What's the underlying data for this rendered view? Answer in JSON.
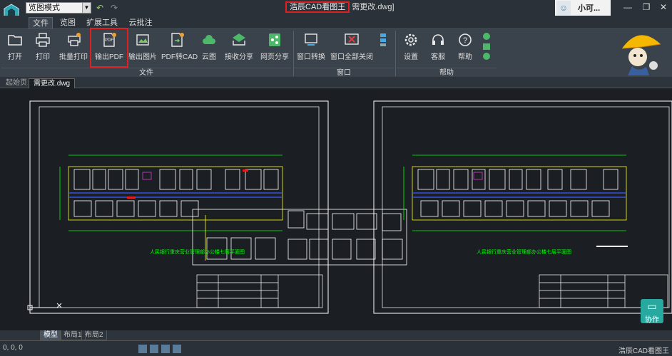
{
  "titlebar": {
    "mode": "览图模式",
    "app_name": "浩辰CAD看图王",
    "file_name": "需更改.dwg]",
    "user": "小可..."
  },
  "tabs": [
    "文件",
    "览图",
    "扩展工具",
    "云批注"
  ],
  "ribbon": {
    "file_group": "文件",
    "window_group": "窗口",
    "help_group": "帮助",
    "buttons": {
      "open": "打开",
      "print": "打印",
      "batch_print": "批量打印",
      "export_pdf": "输出PDF",
      "export_image": "输出图片",
      "pdf_to_cad": "PDF转CAD",
      "cloud": "云图",
      "receive_share": "接收分享",
      "web_share": "网页分享",
      "window_switch": "窗口转换",
      "close_all": "窗口全部关闭",
      "settings": "设置",
      "service": "客服",
      "help": "帮助"
    },
    "pdf_icon_text": "PDF"
  },
  "doc_tabs": {
    "start": "起始页",
    "file": "需更改.dwg"
  },
  "drawing": {
    "title_left": "人民银行重庆营业管理部办公楼七层平面图",
    "title_right": "人民银行重庆营业管理部办公楼七层平面图"
  },
  "collab_label": "协作",
  "layout_tabs": [
    "模型",
    "布局1",
    "布局2"
  ],
  "status": {
    "coords": "0, 0, 0",
    "app_name": "浩辰CAD看图王"
  },
  "colors": {
    "accent_red": "#e02020",
    "cad_yellow": "#ffff00",
    "cad_green": "#00ff00",
    "cad_white": "#ffffff",
    "cad_blue": "#3a5cff",
    "collab": "#28a9a0"
  }
}
